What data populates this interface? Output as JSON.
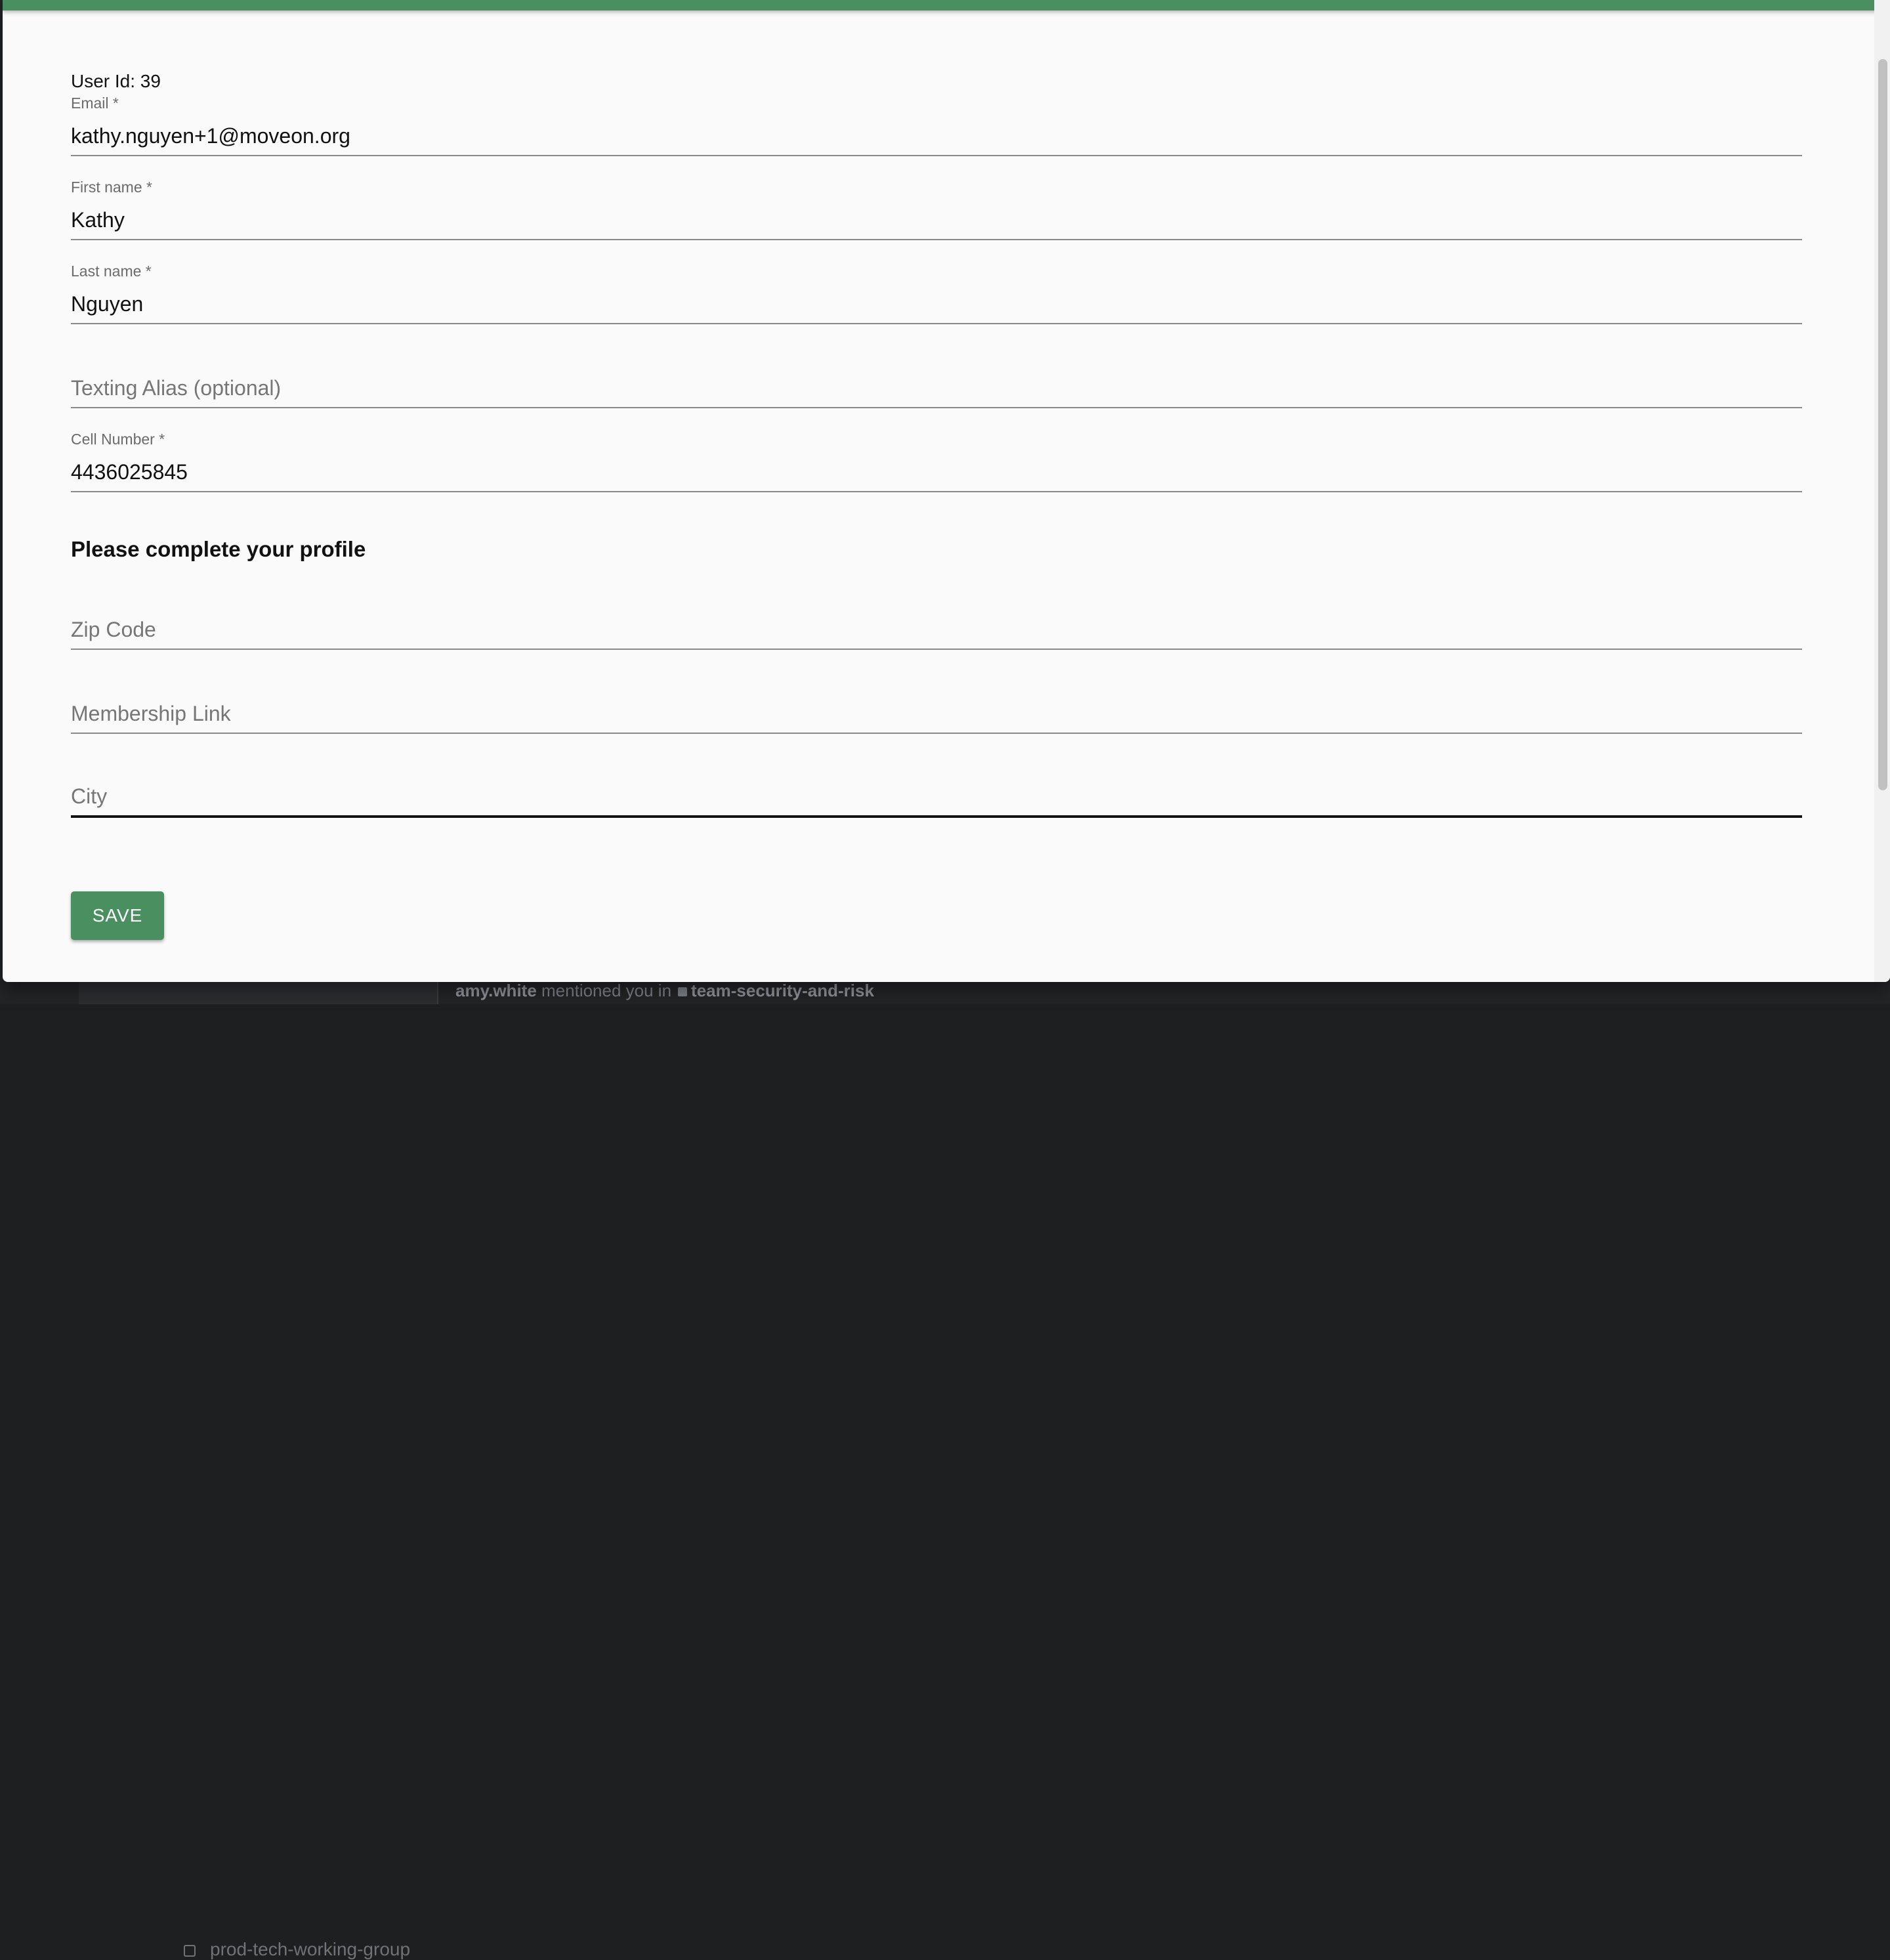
{
  "background": {
    "channel_label": "prod-tech-working-group",
    "notification": {
      "user": "amy.white",
      "text": "mentioned you in",
      "channel": "team-security-and-risk"
    }
  },
  "form": {
    "user_id_label": "User Id: 39",
    "fields": [
      {
        "label": "Email *",
        "value": "kathy.nguyen+1@moveon.org",
        "placeholder": ""
      },
      {
        "label": "First name *",
        "value": "Kathy",
        "placeholder": ""
      },
      {
        "label": "Last name *",
        "value": "Nguyen",
        "placeholder": ""
      },
      {
        "label": "",
        "value": "",
        "placeholder": "Texting Alias (optional)"
      },
      {
        "label": "Cell Number *",
        "value": "4436025845",
        "placeholder": ""
      }
    ],
    "profile_heading": "Please complete your profile",
    "profile_fields": [
      {
        "label": "",
        "value": "",
        "placeholder": "Zip Code"
      },
      {
        "label": "",
        "value": "",
        "placeholder": "Membership Link"
      },
      {
        "label": "",
        "value": "",
        "placeholder": "City"
      }
    ],
    "save_label": "SAVE"
  },
  "colors": {
    "accent": "#4a8f60",
    "text": "#111111",
    "label": "#6b6b6b",
    "surface": "#fafafa"
  }
}
